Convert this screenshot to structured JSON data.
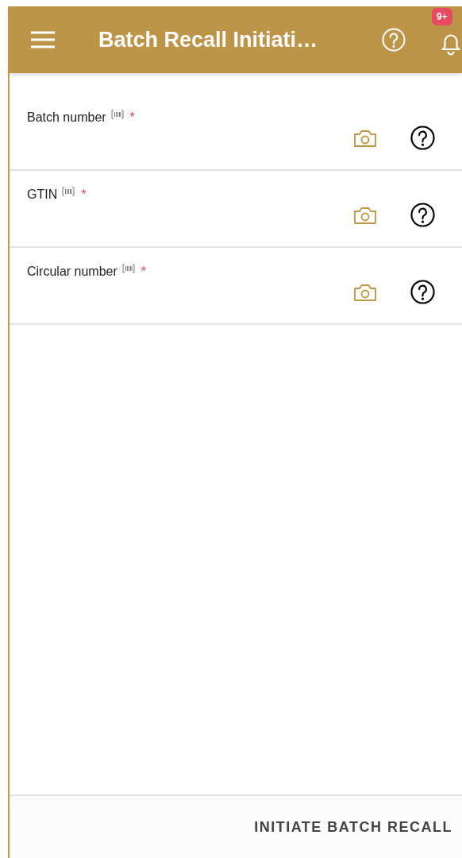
{
  "header": {
    "title": "Batch Recall Initiati…",
    "notification_badge": "9+"
  },
  "fields": [
    {
      "label": "Batch number",
      "required_mark": "*"
    },
    {
      "label": "GTIN",
      "required_mark": "*"
    },
    {
      "label": "Circular number",
      "required_mark": "*"
    }
  ],
  "footer": {
    "button": "INITIATE BATCH RECALL"
  }
}
